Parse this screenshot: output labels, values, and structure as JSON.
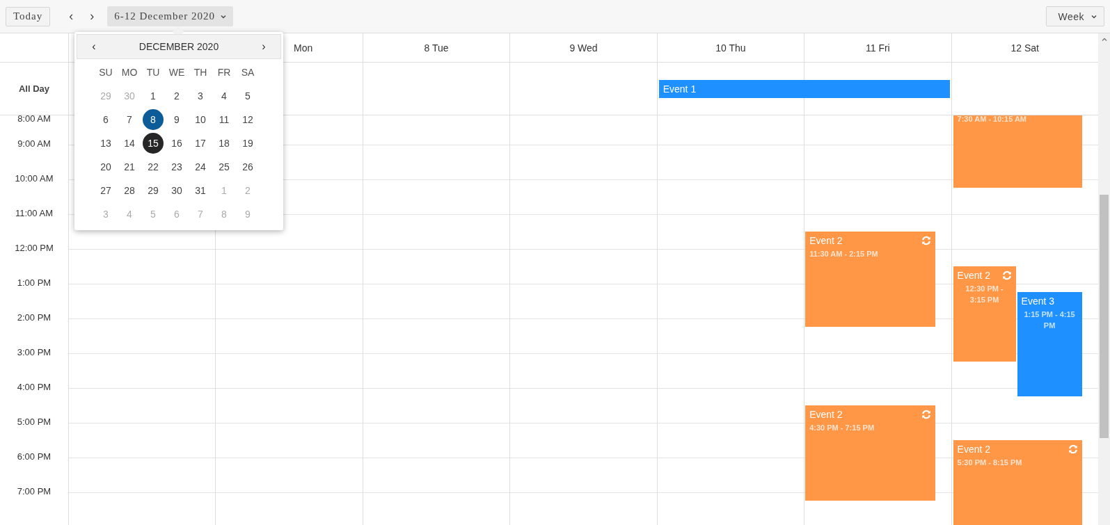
{
  "toolbar": {
    "today_button": "Today",
    "prev_button": "‹",
    "next_button": "›",
    "date_range": "6-12 December 2020",
    "view": "Week"
  },
  "date_picker": {
    "prev_button": "‹",
    "title": "DECEMBER 2020",
    "next_button": "›",
    "weekdays": [
      "SU",
      "MO",
      "TU",
      "WE",
      "TH",
      "FR",
      "SA"
    ],
    "weeks": [
      [
        {
          "label": "29",
          "kind": "outside",
          "selected": false
        },
        {
          "label": "30",
          "kind": "outside",
          "selected": false
        },
        {
          "label": "1",
          "kind": "day",
          "selected": false
        },
        {
          "label": "2",
          "kind": "day",
          "selected": false
        },
        {
          "label": "3",
          "kind": "day",
          "selected": false
        },
        {
          "label": "4",
          "kind": "day",
          "selected": false
        },
        {
          "label": "5",
          "kind": "day",
          "selected": false
        }
      ],
      [
        {
          "label": "6",
          "kind": "day",
          "selected": false
        },
        {
          "label": "7",
          "kind": "day",
          "selected": false
        },
        {
          "label": "8",
          "kind": "day",
          "selected": true
        },
        {
          "label": "9",
          "kind": "day",
          "selected": false
        },
        {
          "label": "10",
          "kind": "day",
          "selected": false
        },
        {
          "label": "11",
          "kind": "day",
          "selected": false
        },
        {
          "label": "12",
          "kind": "day",
          "selected": false
        }
      ],
      [
        {
          "label": "13",
          "kind": "day",
          "selected": false
        },
        {
          "label": "14",
          "kind": "day",
          "selected": false
        },
        {
          "label": "15",
          "kind": "today",
          "selected": false
        },
        {
          "label": "16",
          "kind": "day",
          "selected": false
        },
        {
          "label": "17",
          "kind": "day",
          "selected": false
        },
        {
          "label": "18",
          "kind": "day",
          "selected": false
        },
        {
          "label": "19",
          "kind": "day",
          "selected": false
        }
      ],
      [
        {
          "label": "20",
          "kind": "day",
          "selected": false
        },
        {
          "label": "21",
          "kind": "day",
          "selected": false
        },
        {
          "label": "22",
          "kind": "day",
          "selected": false
        },
        {
          "label": "23",
          "kind": "day",
          "selected": false
        },
        {
          "label": "24",
          "kind": "day",
          "selected": false
        },
        {
          "label": "25",
          "kind": "day",
          "selected": false
        },
        {
          "label": "26",
          "kind": "day",
          "selected": false
        }
      ],
      [
        {
          "label": "27",
          "kind": "day",
          "selected": false
        },
        {
          "label": "28",
          "kind": "day",
          "selected": false
        },
        {
          "label": "29",
          "kind": "day",
          "selected": false
        },
        {
          "label": "30",
          "kind": "day",
          "selected": false
        },
        {
          "label": "31",
          "kind": "day",
          "selected": false
        },
        {
          "label": "1",
          "kind": "outside",
          "selected": false
        },
        {
          "label": "2",
          "kind": "outside",
          "selected": false
        }
      ],
      [
        {
          "label": "3",
          "kind": "outside",
          "selected": false
        },
        {
          "label": "4",
          "kind": "outside",
          "selected": false
        },
        {
          "label": "5",
          "kind": "outside",
          "selected": false
        },
        {
          "label": "6",
          "kind": "outside",
          "selected": false
        },
        {
          "label": "7",
          "kind": "outside",
          "selected": false
        },
        {
          "label": "8",
          "kind": "outside",
          "selected": false
        },
        {
          "label": "9",
          "kind": "outside",
          "selected": false
        }
      ]
    ]
  },
  "day_headers": [
    "Mon",
    "8 Tue",
    "9 Wed",
    "10 Thu",
    "11 Fri",
    "12 Sat"
  ],
  "all_day_label": "All Day",
  "all_day_events": [
    {
      "title": "Event 1",
      "color": "#1e90ff"
    }
  ],
  "time_labels": [
    "8:00 AM",
    "9:00 AM",
    "10:00 AM",
    "11:00 AM",
    "12:00 PM",
    "1:00 PM",
    "2:00 PM",
    "3:00 PM",
    "4:00 PM",
    "5:00 PM",
    "6:00 PM",
    "7:00 PM"
  ],
  "events": [
    {
      "time": "7:30 AM - 10:15 AM",
      "color": "#ff9747"
    },
    {
      "title": "Event 2",
      "time": "11:30 AM - 2:15 PM",
      "color": "#ff9747",
      "recurring": true
    },
    {
      "title": "Event 2",
      "time": "12:30 PM - 3:15 PM",
      "color": "#ff9747",
      "recurring": true
    },
    {
      "title": "Event 3",
      "time": "1:15 PM - 4:15 PM",
      "color": "#1e90ff",
      "recurring": false
    },
    {
      "title": "Event 2",
      "time": "4:30 PM - 7:15 PM",
      "color": "#ff9747",
      "recurring": true
    },
    {
      "title": "Event 2",
      "time": "5:30 PM - 8:15 PM",
      "color": "#ff9747",
      "recurring": true
    }
  ]
}
